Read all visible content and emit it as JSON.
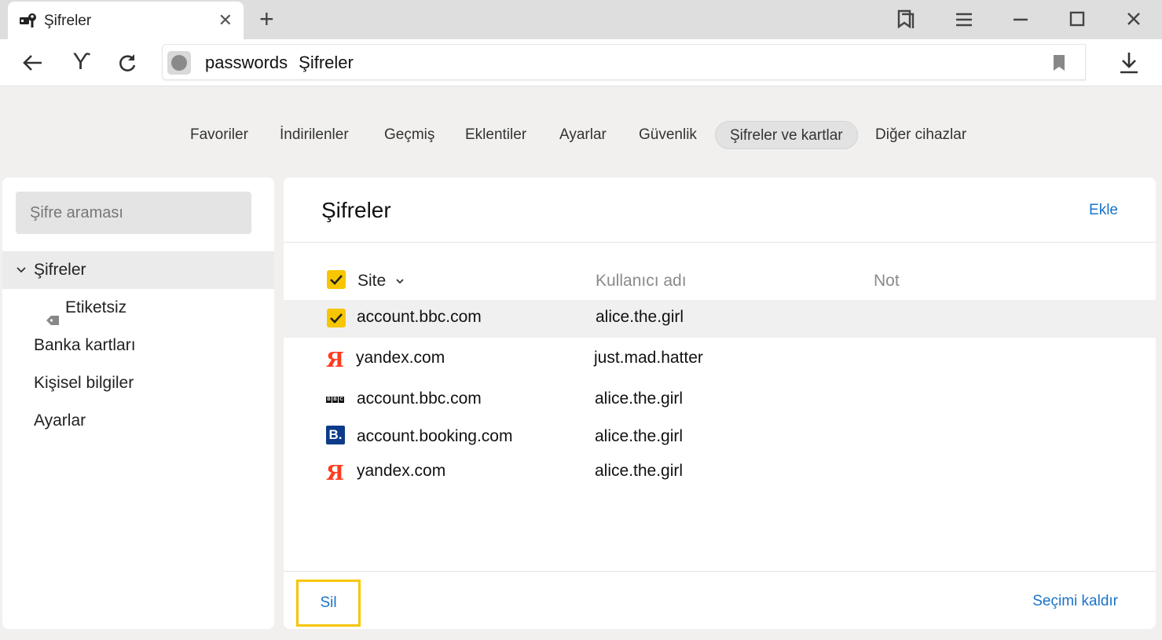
{
  "browser": {
    "tab": {
      "title": "Şifreler",
      "icon": "passwords-icon",
      "close": "✕"
    },
    "new_tab": "+",
    "window_buttons": [
      "bookmarks-panel-icon",
      "menu-icon",
      "minimize-icon",
      "maximize-icon",
      "close-icon"
    ],
    "nav": {
      "back": "back-arrow-icon",
      "yandex": "ϒ",
      "reload": "reload-icon",
      "address_primary": "passwords",
      "address_secondary": "Şifreler",
      "download": "download-icon"
    }
  },
  "topmenu": {
    "items": [
      "Favoriler",
      "İndirilenler",
      "Geçmiş",
      "Eklentiler",
      "Ayarlar",
      "Güvenlik",
      "Şifreler ve kartlar",
      "Diğer cihazlar"
    ],
    "active": "Şifreler ve kartlar"
  },
  "sidebar": {
    "search_placeholder": "Şifre araması",
    "items": [
      {
        "label": "Şifreler",
        "expanded": true,
        "active": true
      },
      {
        "label": "Etiketsiz",
        "sub": true
      },
      {
        "label": "Banka kartları"
      },
      {
        "label": "Kişisel bilgiler"
      },
      {
        "label": "Ayarlar"
      }
    ]
  },
  "main": {
    "title": "Şifreler",
    "add_link": "Ekle",
    "columns": {
      "site": "Site",
      "username": "Kullanıcı adı",
      "note": "Not"
    },
    "rows": [
      {
        "site": "account.bbc.com",
        "username": "alice.the.girl",
        "favicon": "checkbox-checked",
        "selected": true
      },
      {
        "site": "yandex.com",
        "username": "just.mad.hatter",
        "favicon": "yandex-icon"
      },
      {
        "site": "account.bbc.com",
        "username": "alice.the.girl",
        "favicon": "bbc-icon"
      },
      {
        "site": "account.booking.com",
        "username": "alice.the.girl",
        "favicon": "booking-icon"
      },
      {
        "site": "yandex.com",
        "username": "alice.the.girl",
        "favicon": "yandex-icon"
      }
    ],
    "delete_button": "Sil",
    "deselect_link": "Seçimi kaldır"
  },
  "colors": {
    "accent_yellow": "#f7c600",
    "link_blue": "#1a73c9",
    "yandex_red": "#ff3b1f",
    "booking_blue": "#0c3b8a"
  }
}
